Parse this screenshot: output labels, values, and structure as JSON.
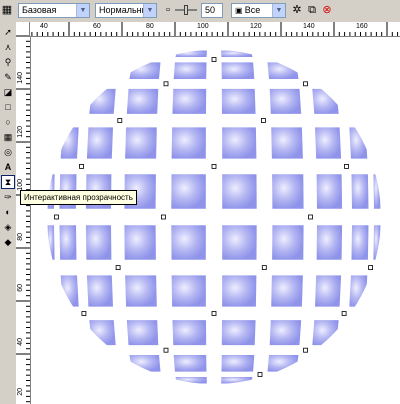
{
  "propbar": {
    "style_select": "Базовая",
    "mode_select": "Нормальные",
    "transparency_value": "50",
    "target_select": "Все"
  },
  "ruler": {
    "h_labels": [
      "40",
      "60",
      "80",
      "100",
      "120",
      "140",
      "160"
    ],
    "v_labels": [
      "140",
      "120",
      "100",
      "80",
      "60",
      "40",
      "20"
    ]
  },
  "tooltip": "Интерактивная прозрачность",
  "colors": {
    "tile": "#8f94ea",
    "tile_light": "#eeeeff",
    "bg": "#d4d0c8"
  },
  "icons": {
    "toolbox": [
      "pick-icon",
      "shape-icon",
      "zoom-icon",
      "freehand-icon",
      "smart-fill-icon",
      "rectangle-icon",
      "ellipse-icon",
      "polygon-icon",
      "basic-shapes-icon",
      "text-icon",
      "interactive-blend-icon",
      "eyedropper-icon",
      "outline-icon",
      "fill-icon",
      "interactive-fill-icon"
    ]
  }
}
